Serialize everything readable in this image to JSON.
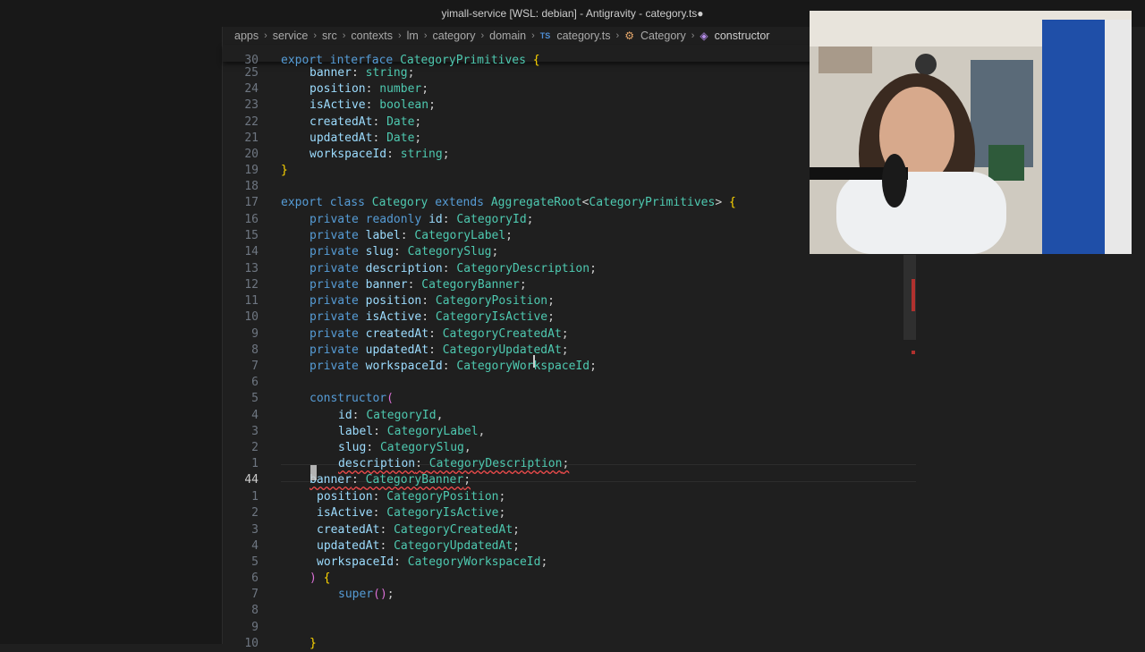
{
  "window": {
    "title": "yimall-service [WSL: debian] - Antigravity - category.ts●"
  },
  "breadcrumb": {
    "items": [
      "apps",
      "service",
      "src",
      "contexts",
      "lm",
      "category",
      "domain",
      "category.ts",
      "Category",
      "constructor"
    ]
  },
  "editor": {
    "current_line_number": "44",
    "lines": [
      {
        "n": "30",
        "t": "export interface CategoryPrimitives {"
      },
      {
        "n": "25",
        "t": "banner: string;"
      },
      {
        "n": "24",
        "t": "position: number;"
      },
      {
        "n": "23",
        "t": "isActive: boolean;"
      },
      {
        "n": "22",
        "t": "createdAt: Date;"
      },
      {
        "n": "21",
        "t": "updatedAt: Date;"
      },
      {
        "n": "20",
        "t": "workspaceId: string;"
      },
      {
        "n": "19",
        "t": "}"
      },
      {
        "n": "18",
        "t": ""
      },
      {
        "n": "17",
        "t": "export class Category extends AggregateRoot<CategoryPrimitives> {"
      },
      {
        "n": "16",
        "t": "private readonly id: CategoryId;"
      },
      {
        "n": "15",
        "t": "private label: CategoryLabel;"
      },
      {
        "n": "14",
        "t": "private slug: CategorySlug;"
      },
      {
        "n": "13",
        "t": "private description: CategoryDescription;"
      },
      {
        "n": "12",
        "t": "private banner: CategoryBanner;"
      },
      {
        "n": "11",
        "t": "private position: CategoryPosition;"
      },
      {
        "n": "10",
        "t": "private isActive: CategoryIsActive;"
      },
      {
        "n": "9",
        "t": "private createdAt: CategoryCreatedAt;"
      },
      {
        "n": "8",
        "t": "private updatedAt: CategoryUpdatedAt;"
      },
      {
        "n": "7",
        "t": "private workspaceId: CategoryWorkspaceId;"
      },
      {
        "n": "6",
        "t": ""
      },
      {
        "n": "5",
        "t": "constructor("
      },
      {
        "n": "4",
        "t": "id: CategoryId,"
      },
      {
        "n": "3",
        "t": "label: CategoryLabel,"
      },
      {
        "n": "2",
        "t": "slug: CategorySlug,"
      },
      {
        "n": "1",
        "t": "description: CategoryDescription;"
      },
      {
        "n": "44",
        "t": "banner: CategoryBanner;"
      },
      {
        "n": "1",
        "t": "position: CategoryPosition;"
      },
      {
        "n": "2",
        "t": "isActive: CategoryIsActive;"
      },
      {
        "n": "3",
        "t": "createdAt: CategoryCreatedAt;"
      },
      {
        "n": "4",
        "t": "updatedAt: CategoryUpdatedAt;"
      },
      {
        "n": "5",
        "t": "workspaceId: CategoryWorkspaceId;"
      },
      {
        "n": "6",
        "t": ") {"
      },
      {
        "n": "7",
        "t": "super();"
      },
      {
        "n": "8",
        "t": ""
      },
      {
        "n": "9",
        "t": ""
      },
      {
        "n": "10",
        "t": "}"
      }
    ]
  },
  "colors": {
    "editor_bg": "#1f1f1f",
    "keyword": "#569cd6",
    "type": "#4ec9b0",
    "property": "#9cdcfe",
    "error": "#f14c4c"
  },
  "header_icons": [
    "layout-icon",
    "more-icon",
    "close-icon"
  ]
}
